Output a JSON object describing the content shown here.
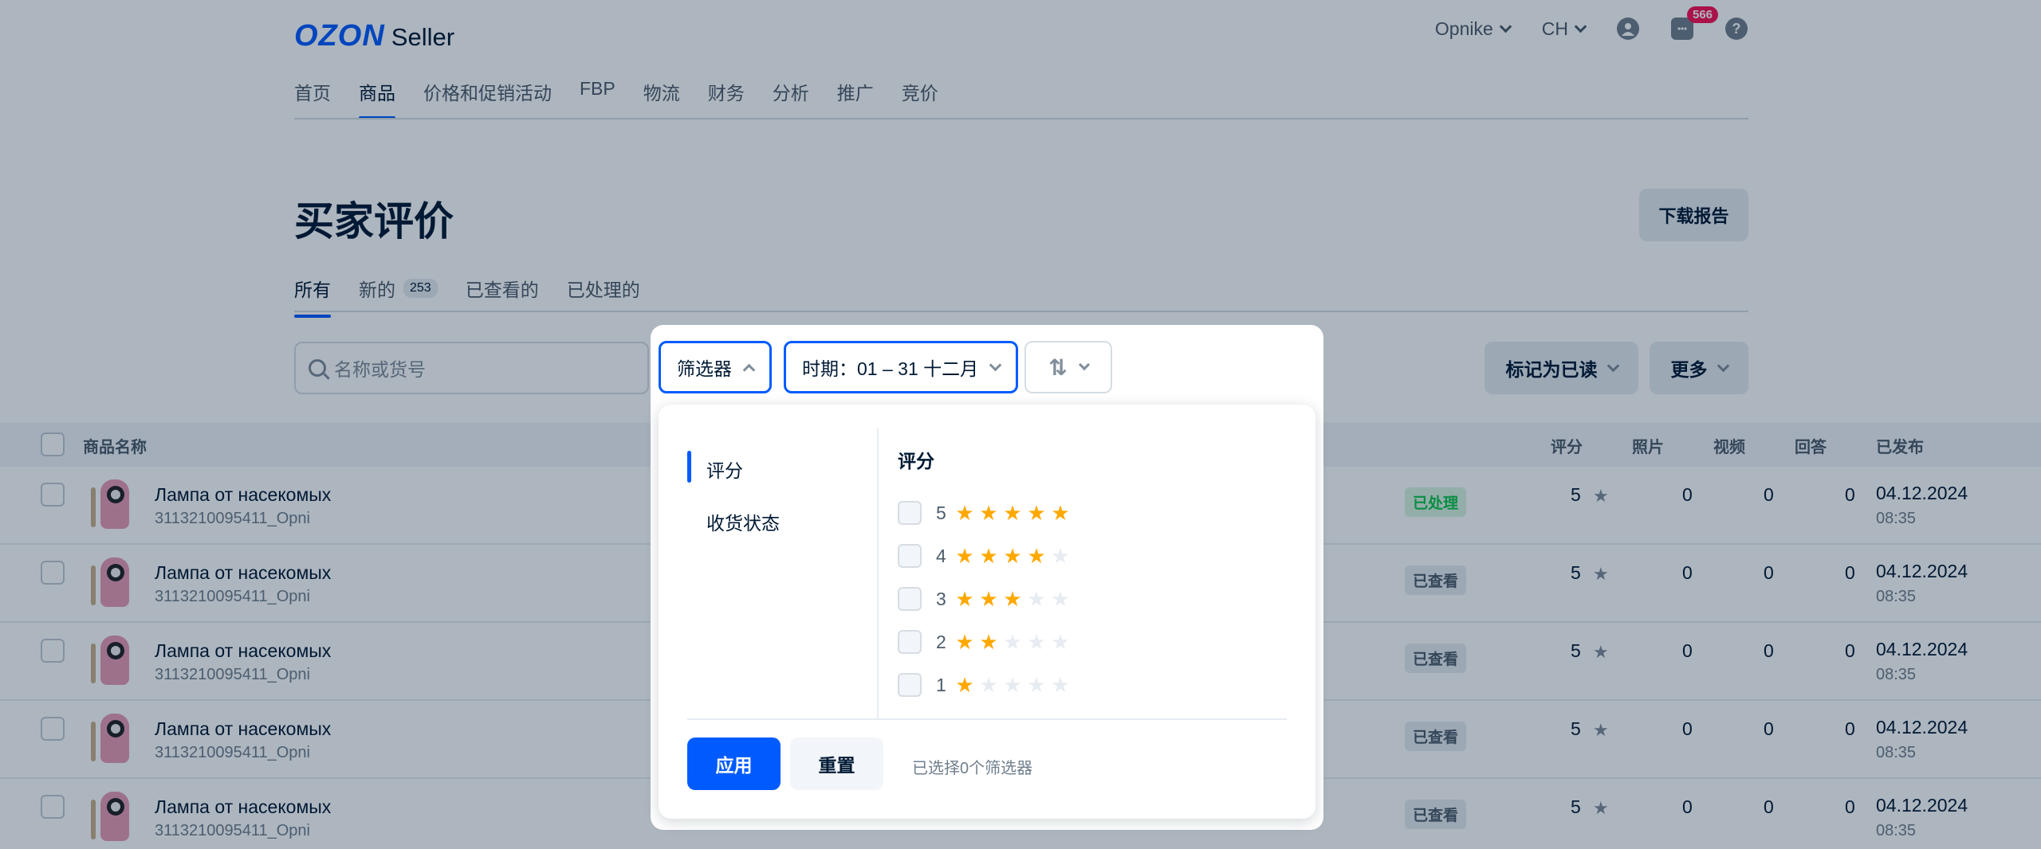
{
  "header": {
    "logo_main": "OZON",
    "logo_sub": "Seller",
    "company": "Opnike",
    "currency": "CH",
    "chat_badge": "566",
    "help": "?"
  },
  "nav": [
    "首页",
    "商品",
    "价格和促销活动",
    "FBP",
    "物流",
    "财务",
    "分析",
    "推广",
    "竞价"
  ],
  "page": {
    "title": "买家评价",
    "download_label": "下载报告"
  },
  "tabs": [
    {
      "label": "所有"
    },
    {
      "label": "新的",
      "count": "253"
    },
    {
      "label": "已查看的"
    },
    {
      "label": "已处理的"
    }
  ],
  "toolbar": {
    "search_placeholder": "名称或货号",
    "mark_read_label": "标记为已读",
    "more_label": "更多"
  },
  "table": {
    "columns": {
      "name": "商品名称",
      "rating": "评分",
      "photos": "照片",
      "videos": "视频",
      "answers": "回答",
      "published": "已发布"
    },
    "rows": [
      {
        "name": "Лампа от насекомых",
        "sku": "3113210095411_Opni",
        "status": "已处理",
        "status_type": "processed",
        "rating": "5",
        "photos": "0",
        "videos": "0",
        "answers": "0",
        "date": "04.12.2024",
        "time": "08:35"
      },
      {
        "name": "Лампа от насекомых",
        "sku": "3113210095411_Opni",
        "status": "已查看",
        "status_type": "viewed",
        "rating": "5",
        "photos": "0",
        "videos": "0",
        "answers": "0",
        "date": "04.12.2024",
        "time": "08:35"
      },
      {
        "name": "Лампа от насекомых",
        "sku": "3113210095411_Opni",
        "status": "已查看",
        "status_type": "viewed",
        "rating": "5",
        "photos": "0",
        "videos": "0",
        "answers": "0",
        "date": "04.12.2024",
        "time": "08:35"
      },
      {
        "name": "Лампа от насекомых",
        "sku": "3113210095411_Opni",
        "status": "已查看",
        "status_type": "viewed",
        "rating": "5",
        "photos": "0",
        "videos": "0",
        "answers": "0",
        "date": "04.12.2024",
        "time": "08:35"
      },
      {
        "name": "Лампа от насекомых",
        "sku": "3113210095411_Opni",
        "status": "已查看",
        "status_type": "viewed",
        "rating": "5",
        "photos": "0",
        "videos": "0",
        "answers": "0",
        "date": "04.12.2024",
        "time": "08:35"
      }
    ]
  },
  "popup": {
    "filter_label": "筛选器",
    "period_label": "时期：01 – 31 十二月",
    "sort_icon": "sort-arrows-icon",
    "sidebar": [
      "评分",
      "收货状态"
    ],
    "section_title": "评分",
    "ratings": [
      {
        "label": "5",
        "stars": 5
      },
      {
        "label": "4",
        "stars": 4
      },
      {
        "label": "3",
        "stars": 3
      },
      {
        "label": "2",
        "stars": 2
      },
      {
        "label": "1",
        "stars": 1
      }
    ],
    "apply_label": "应用",
    "reset_label": "重置",
    "selected_info": "已选择0个筛选器"
  },
  "colors": {
    "accent": "#005bff",
    "star": "#ffa800",
    "badge": "#f91155"
  }
}
